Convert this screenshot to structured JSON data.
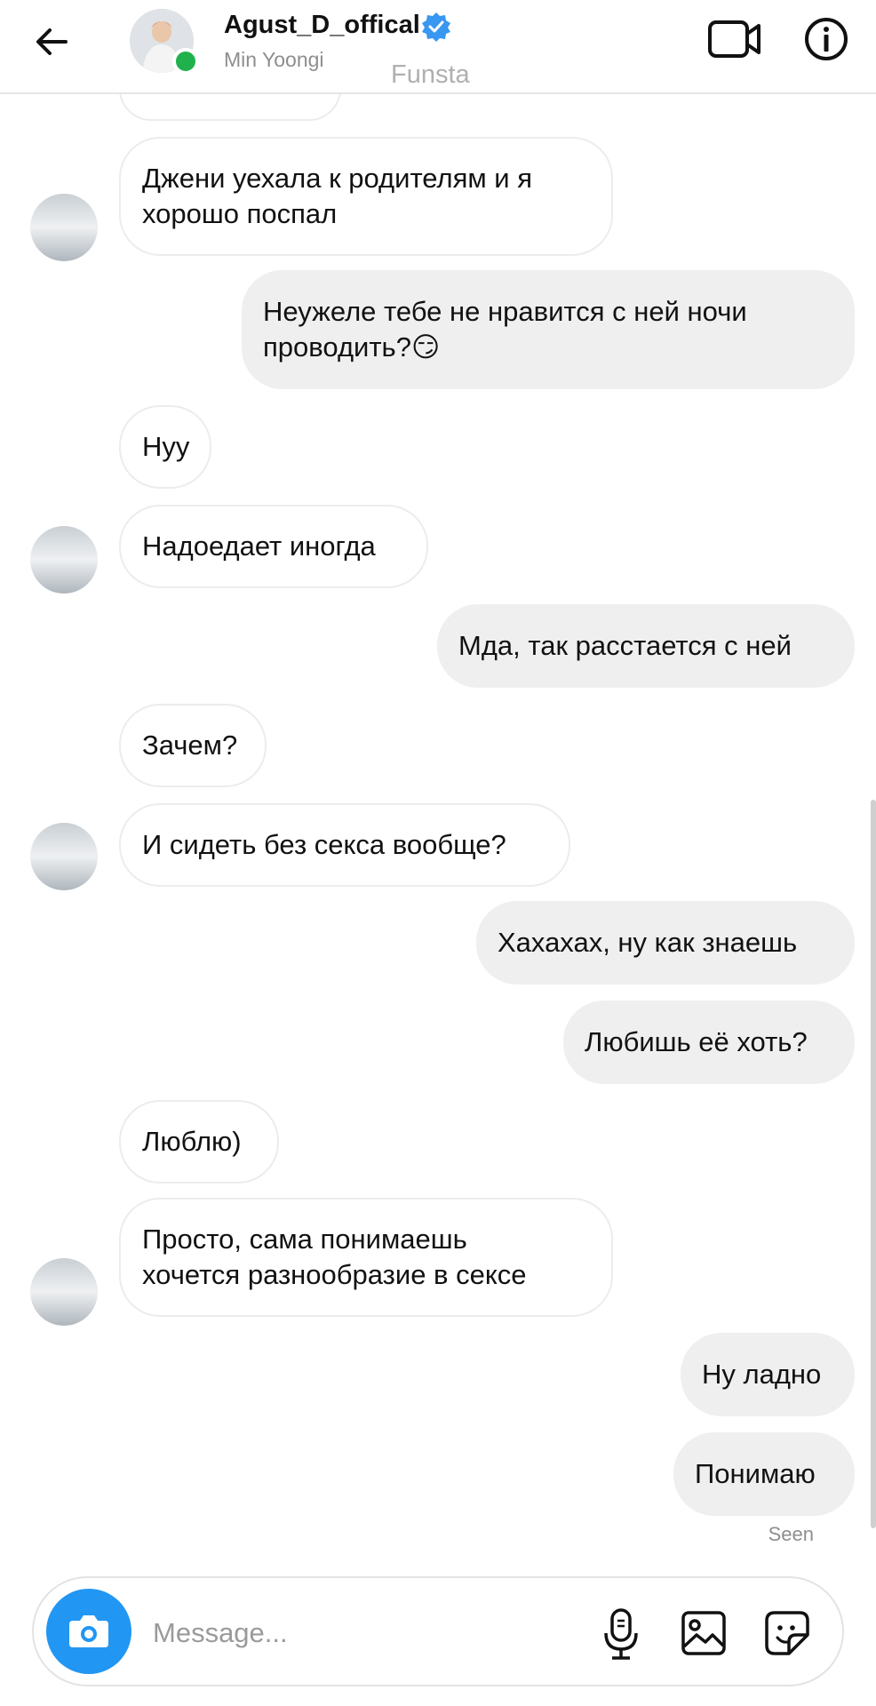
{
  "header": {
    "username": "Agust_D_offical",
    "subname": "Min Yoongi",
    "watermark": "Funsta"
  },
  "messages": [
    {
      "side": "in",
      "text": "Джени уехала к родителям и я\nхорошо поспал"
    },
    {
      "side": "out",
      "text": "Неужеле тебе не нравится с ней ночи\nпроводить?😏"
    },
    {
      "side": "in",
      "text": "Нуу"
    },
    {
      "side": "in",
      "text": "Надоедает иногда"
    },
    {
      "side": "out",
      "text": "Мда, так расстается с ней"
    },
    {
      "side": "in",
      "text": "Зачем?"
    },
    {
      "side": "in",
      "text": "И сидеть без секса вообще?"
    },
    {
      "side": "out",
      "text": "Хахахах, ну как знаешь"
    },
    {
      "side": "out",
      "text": "Любишь её хоть?"
    },
    {
      "side": "in",
      "text": "Люблю)"
    },
    {
      "side": "in",
      "text": "Просто, сама понимаешь\nхочется разнообразие в сексе"
    },
    {
      "side": "out",
      "text": "Ну ладно"
    },
    {
      "side": "out",
      "text": "Понимаю"
    }
  ],
  "seen_label": "Seen",
  "composer": {
    "placeholder": "Message..."
  },
  "colors": {
    "accent": "#2196f3",
    "verified": "#3897f0",
    "online": "#20b14c",
    "outgoing_bubble": "#efefef"
  },
  "icons": [
    "back-arrow-icon",
    "video-call-icon",
    "info-icon",
    "camera-icon",
    "microphone-icon",
    "gallery-icon",
    "sticker-icon",
    "verified-badge-icon"
  ]
}
